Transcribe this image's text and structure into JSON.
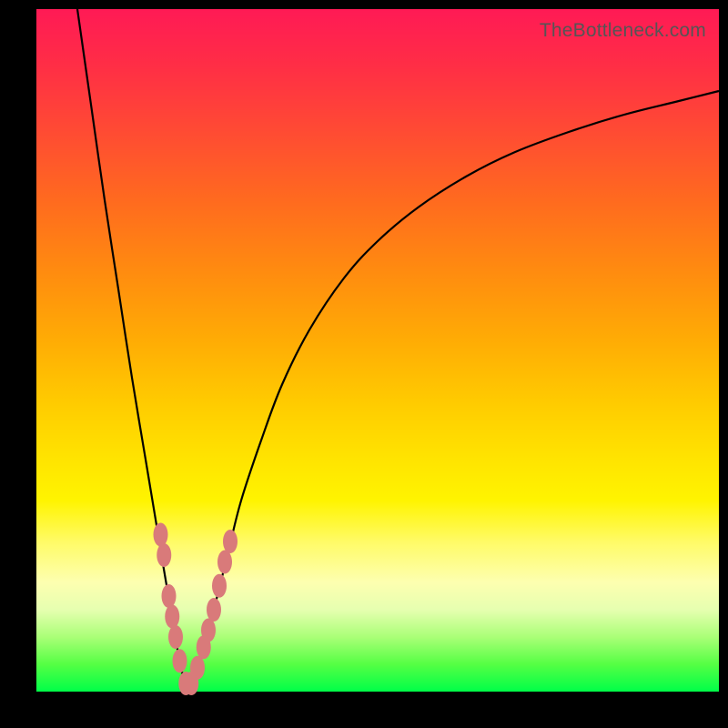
{
  "watermark": "TheBottleneck.com",
  "colors": {
    "frame": "#000000",
    "curve": "#000000",
    "marker_fill": "#d97a7a",
    "marker_stroke": "#c96b6b"
  },
  "chart_data": {
    "type": "line",
    "title": "",
    "xlabel": "",
    "ylabel": "",
    "xlim": [
      0,
      100
    ],
    "ylim": [
      0,
      100
    ],
    "grid": false,
    "series": [
      {
        "name": "left-branch",
        "x": [
          6,
          8,
          10,
          12,
          14,
          16,
          18,
          19,
          20,
          20.7,
          21.3,
          22
        ],
        "y": [
          100,
          86,
          72,
          59,
          46,
          34,
          22,
          16,
          10.5,
          6,
          3,
          0.5
        ]
      },
      {
        "name": "right-branch",
        "x": [
          22,
          23,
          24,
          25,
          26,
          28,
          30,
          33,
          36,
          40,
          45,
          50,
          56,
          63,
          70,
          78,
          86,
          94,
          100
        ],
        "y": [
          0.5,
          2,
          4.5,
          8,
          12,
          20,
          28,
          37,
          45,
          53,
          60.5,
          66,
          71,
          75.5,
          79,
          82,
          84.5,
          86.5,
          88
        ]
      }
    ],
    "markers": {
      "name": "data-points",
      "points": [
        {
          "x": 18.2,
          "y": 23
        },
        {
          "x": 18.7,
          "y": 20
        },
        {
          "x": 19.4,
          "y": 14
        },
        {
          "x": 19.9,
          "y": 11
        },
        {
          "x": 20.4,
          "y": 8
        },
        {
          "x": 21.0,
          "y": 4.5
        },
        {
          "x": 21.9,
          "y": 1.2
        },
        {
          "x": 22.7,
          "y": 1.2
        },
        {
          "x": 23.6,
          "y": 3.5
        },
        {
          "x": 24.5,
          "y": 6.5
        },
        {
          "x": 25.2,
          "y": 9
        },
        {
          "x": 26.0,
          "y": 12
        },
        {
          "x": 26.8,
          "y": 15.5
        },
        {
          "x": 27.6,
          "y": 19
        },
        {
          "x": 28.4,
          "y": 22
        }
      ]
    }
  }
}
